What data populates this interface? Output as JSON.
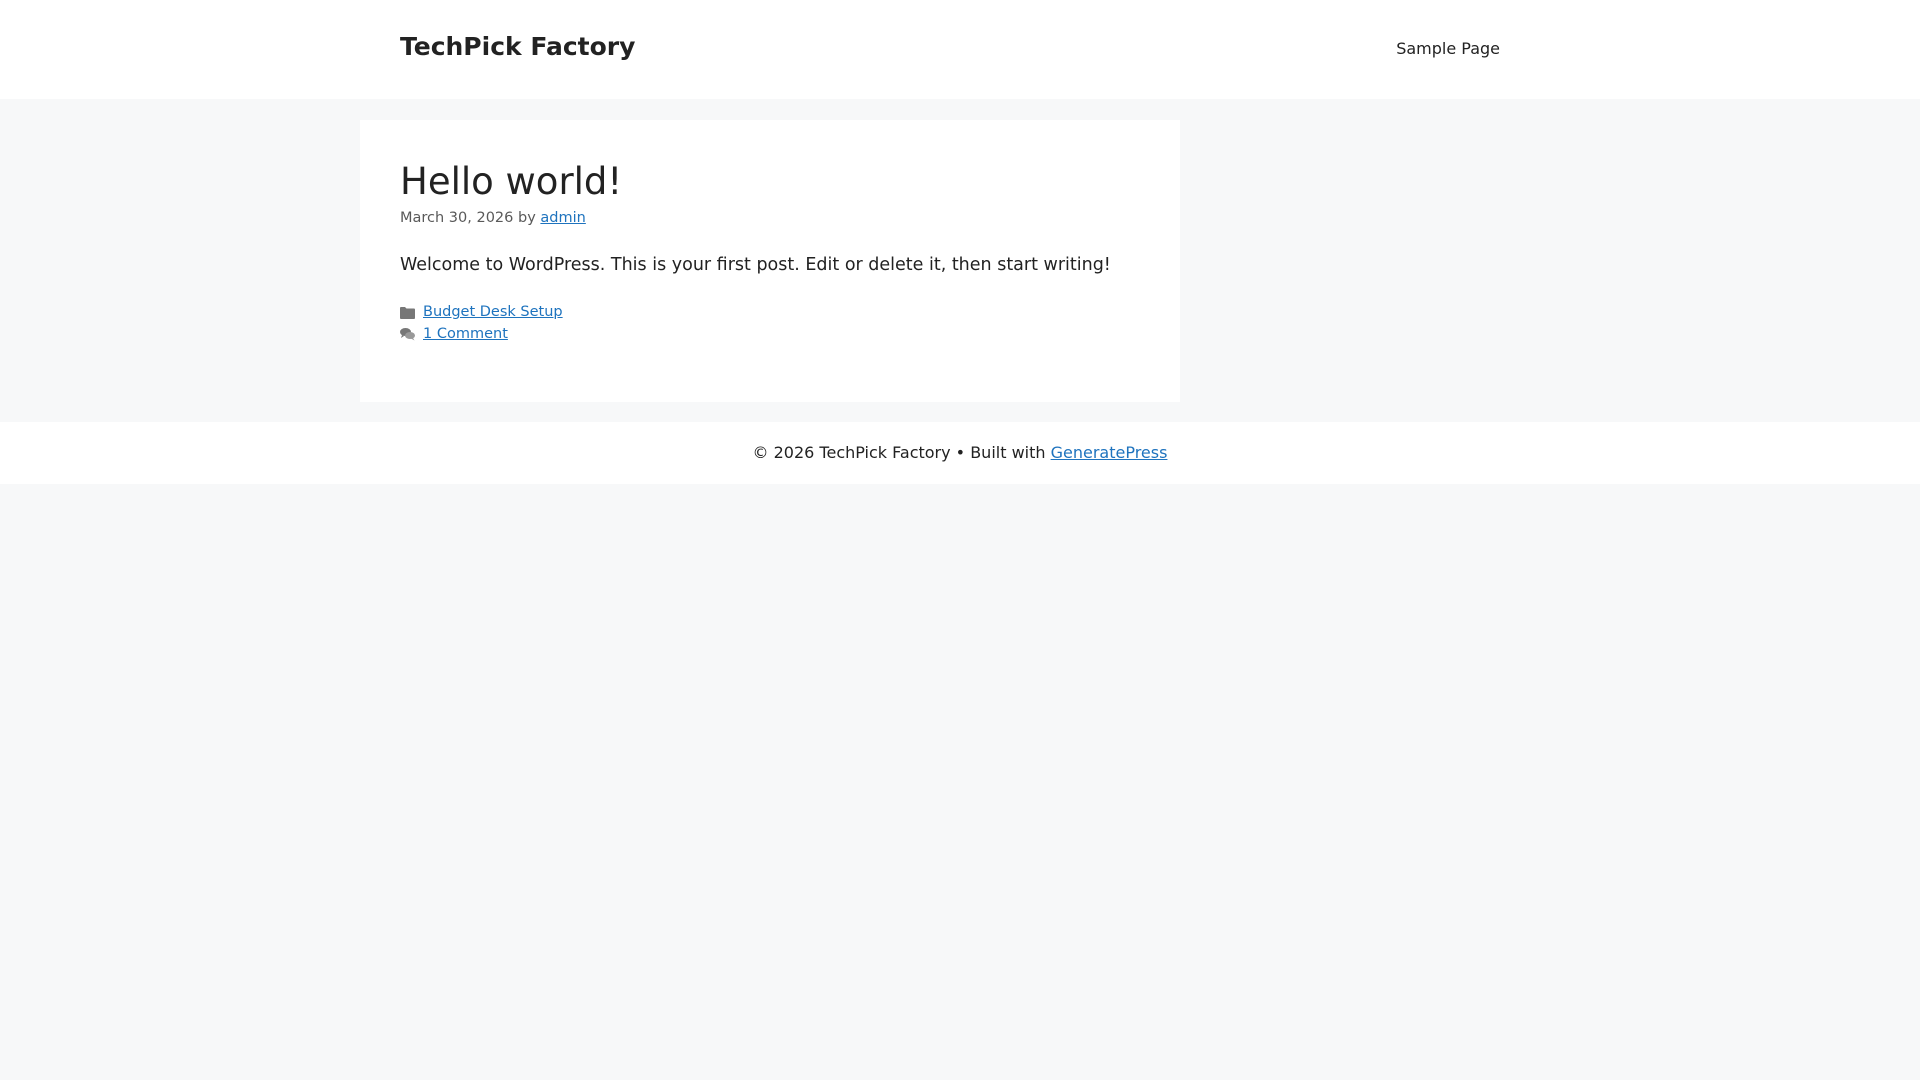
{
  "header": {
    "site_title": "TechPick Factory",
    "nav": [
      "Sample Page"
    ]
  },
  "post": {
    "title": "Hello world!",
    "date": "March 30, 2026",
    "by": "by",
    "author": "admin",
    "content": "Welcome to WordPress. This is your first post. Edit or delete it, then start writing!",
    "category": "Budget Desk Setup",
    "comments": "1 Comment"
  },
  "footer": {
    "text": "© 2026 TechPick Factory • Built with",
    "link": "GeneratePress"
  }
}
